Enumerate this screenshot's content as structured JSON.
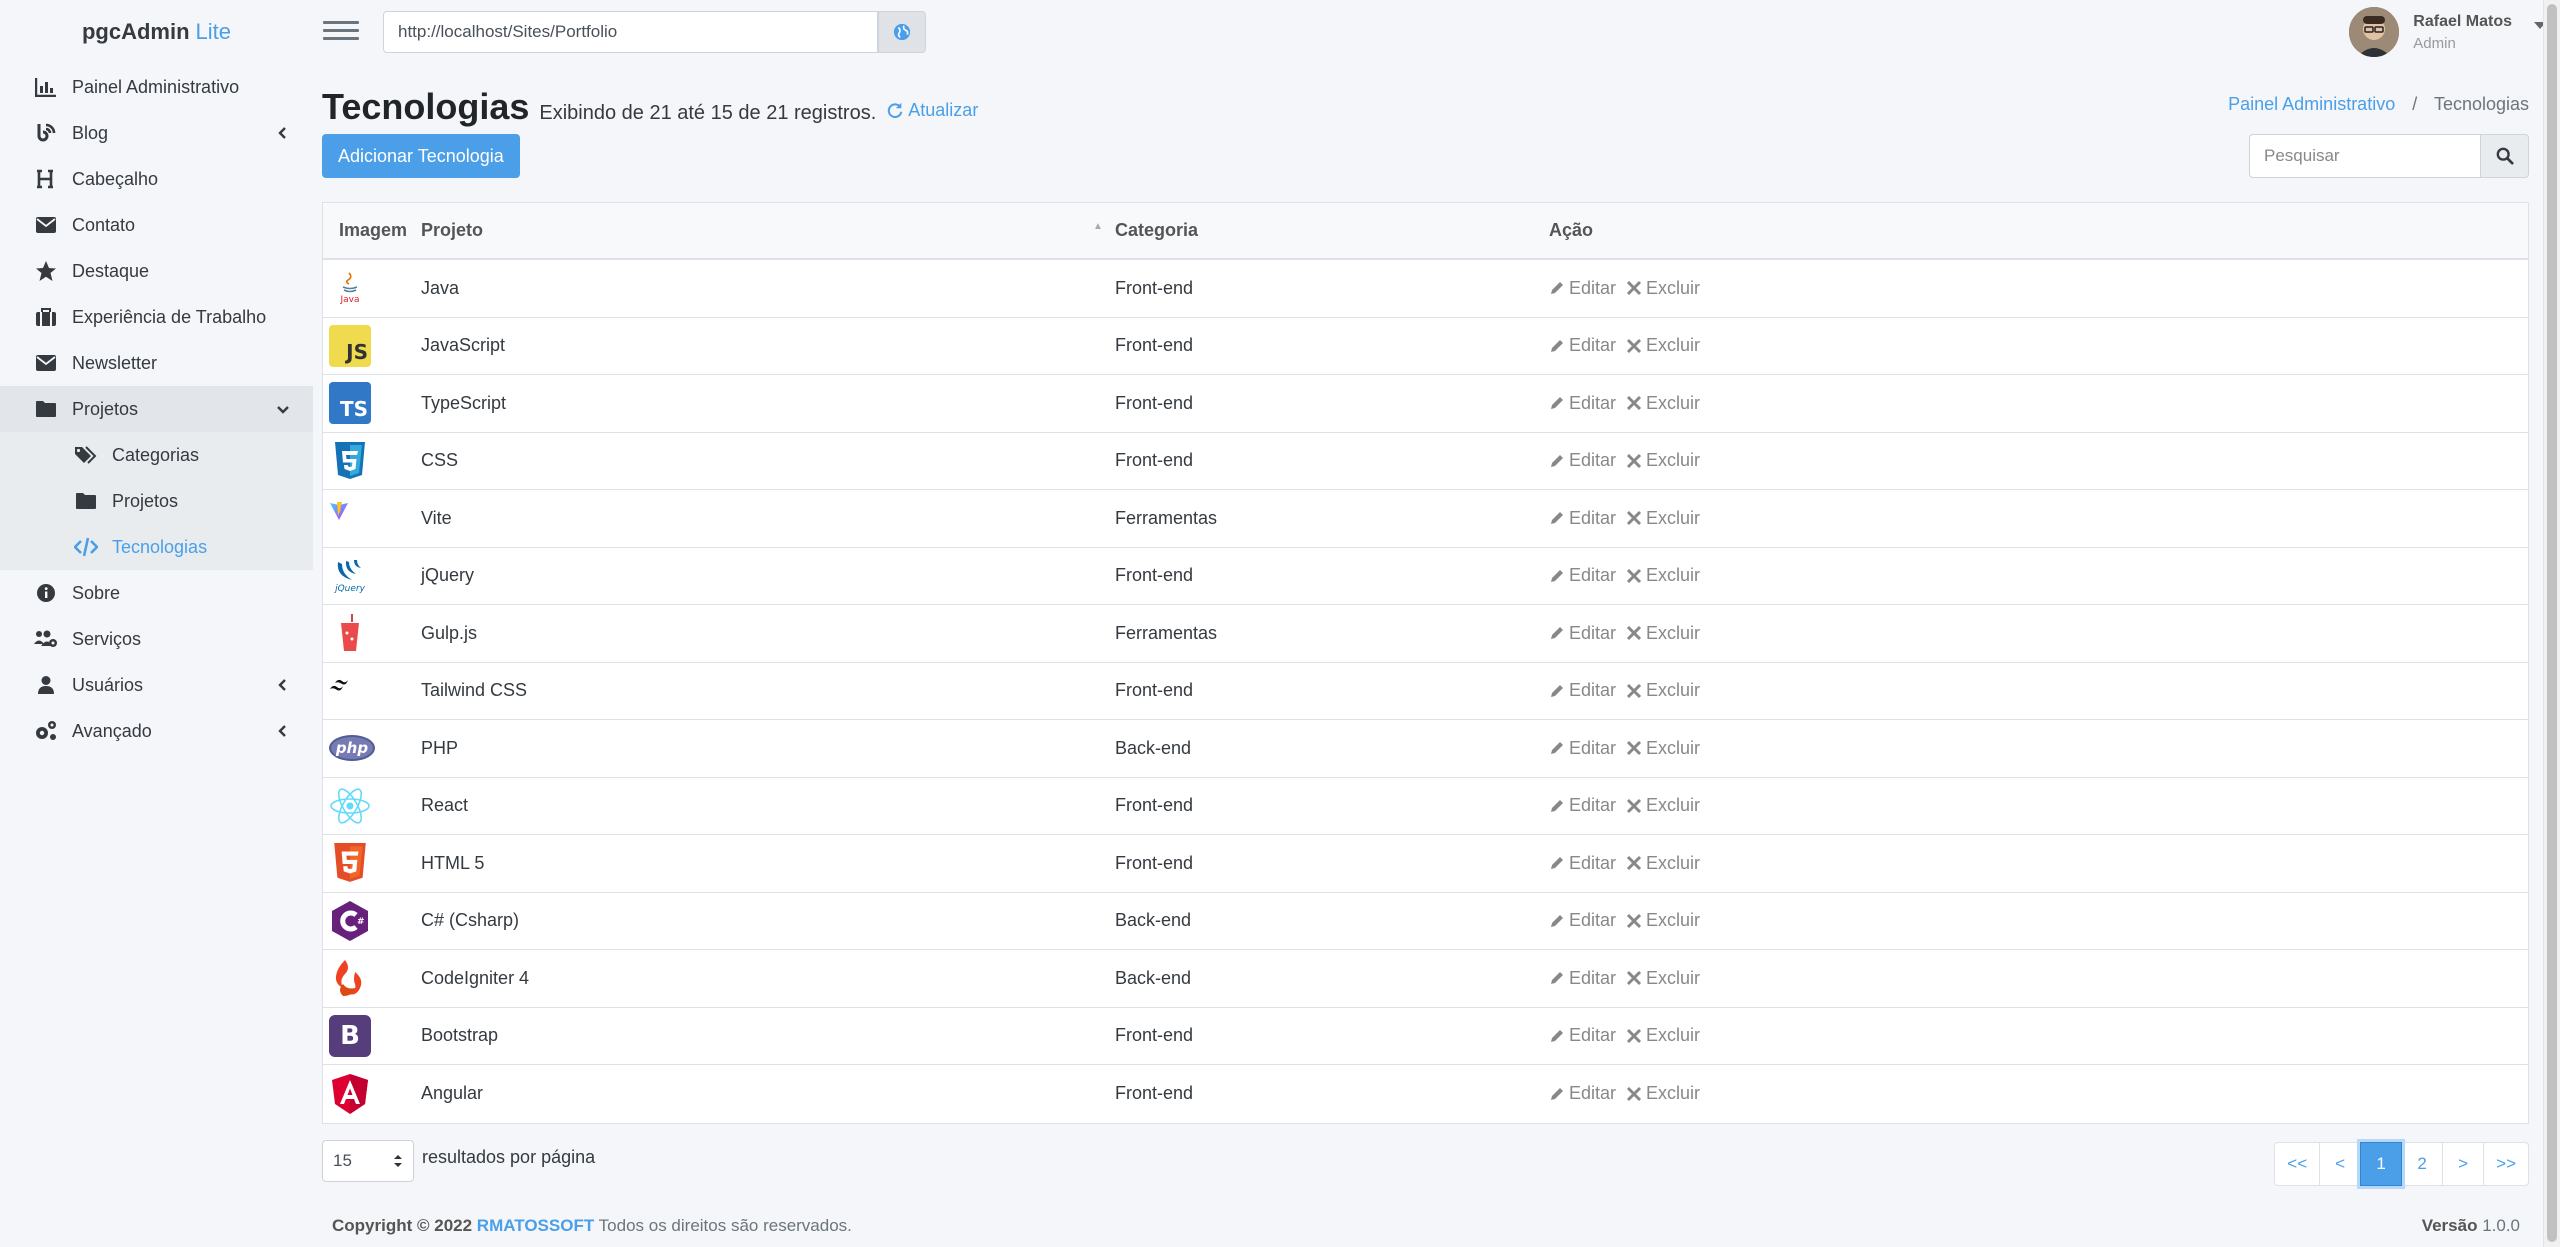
{
  "brand": {
    "name": "pgcAdmin",
    "suffix": "Lite"
  },
  "sidebar": {
    "items": [
      {
        "label": "Painel Administrativo",
        "icon": "chart-bar-icon"
      },
      {
        "label": "Blog",
        "icon": "blog-icon",
        "has_children": true
      },
      {
        "label": "Cabeçalho",
        "icon": "heading-icon"
      },
      {
        "label": "Contato",
        "icon": "envelope-icon"
      },
      {
        "label": "Destaque",
        "icon": "star-icon"
      },
      {
        "label": "Experiência de Trabalho",
        "icon": "briefcase-icon"
      },
      {
        "label": "Newsletter",
        "icon": "envelope-icon"
      },
      {
        "label": "Projetos",
        "icon": "folder-icon",
        "open": true
      },
      {
        "label": "Sobre",
        "icon": "info-circle-icon"
      },
      {
        "label": "Serviços",
        "icon": "users-cog-icon"
      },
      {
        "label": "Usuários",
        "icon": "user-icon",
        "has_children": true
      },
      {
        "label": "Avançado",
        "icon": "cogs-icon",
        "has_children": true
      }
    ],
    "subitems": [
      {
        "label": "Categorias",
        "icon": "tags-icon"
      },
      {
        "label": "Projetos",
        "icon": "folder-icon"
      },
      {
        "label": "Tecnologias",
        "icon": "code-icon",
        "active": true
      }
    ]
  },
  "header": {
    "url": "http://localhost/Sites/Portfolio",
    "user_name": "Rafael Matos",
    "user_role": "Admin"
  },
  "page": {
    "title": "Tecnologias",
    "subtitle": "Exibindo de 21 até 15 de 21 registros.",
    "refresh_label": "Atualizar",
    "breadcrumb_home": "Painel Administrativo",
    "breadcrumb_sep": "/",
    "breadcrumb_current": "Tecnologias",
    "add_button": "Adicionar Tecnologia",
    "search_placeholder": "Pesquisar"
  },
  "table": {
    "headers": {
      "image": "Imagem",
      "project": "Projeto",
      "category": "Categoria",
      "action": "Ação"
    },
    "edit_label": "Editar",
    "delete_label": "Excluir",
    "rows": [
      {
        "project": "Java",
        "category": "Front-end",
        "logo": "java"
      },
      {
        "project": "JavaScript",
        "category": "Front-end",
        "logo": "js"
      },
      {
        "project": "TypeScript",
        "category": "Front-end",
        "logo": "ts"
      },
      {
        "project": "CSS",
        "category": "Front-end",
        "logo": "css"
      },
      {
        "project": "Vite",
        "category": "Ferramentas",
        "logo": "vite"
      },
      {
        "project": "jQuery",
        "category": "Front-end",
        "logo": "jquery"
      },
      {
        "project": "Gulp.js",
        "category": "Ferramentas",
        "logo": "gulp"
      },
      {
        "project": "Tailwind CSS",
        "category": "Front-end",
        "logo": "tailwind"
      },
      {
        "project": "PHP",
        "category": "Back-end",
        "logo": "php"
      },
      {
        "project": "React",
        "category": "Front-end",
        "logo": "react"
      },
      {
        "project": "HTML 5",
        "category": "Front-end",
        "logo": "html5"
      },
      {
        "project": "C# (Csharp)",
        "category": "Back-end",
        "logo": "csharp"
      },
      {
        "project": "CodeIgniter 4",
        "category": "Back-end",
        "logo": "codeigniter"
      },
      {
        "project": "Bootstrap",
        "category": "Front-end",
        "logo": "bootstrap"
      },
      {
        "project": "Angular",
        "category": "Front-end",
        "logo": "angular"
      }
    ],
    "logo_text": {
      "java": "Java",
      "js": "JS",
      "ts": "TS",
      "php": "php",
      "jquery": "jQuery",
      "bootstrap": "B"
    }
  },
  "pagination": {
    "per_page_value": "15",
    "per_page_label": "resultados por página",
    "buttons": [
      "<<",
      "<",
      "1",
      "2",
      ">",
      ">>"
    ],
    "active": "1"
  },
  "footer": {
    "copyright": "Copyright © 2022",
    "company": "RMATOSSOFT",
    "rights": "Todos os direitos são reservados.",
    "version_label": "Versão",
    "version": "1.0.0"
  },
  "colors": {
    "accent": "#4a9fe8",
    "sidebar_bg": "#f4f6f9"
  }
}
